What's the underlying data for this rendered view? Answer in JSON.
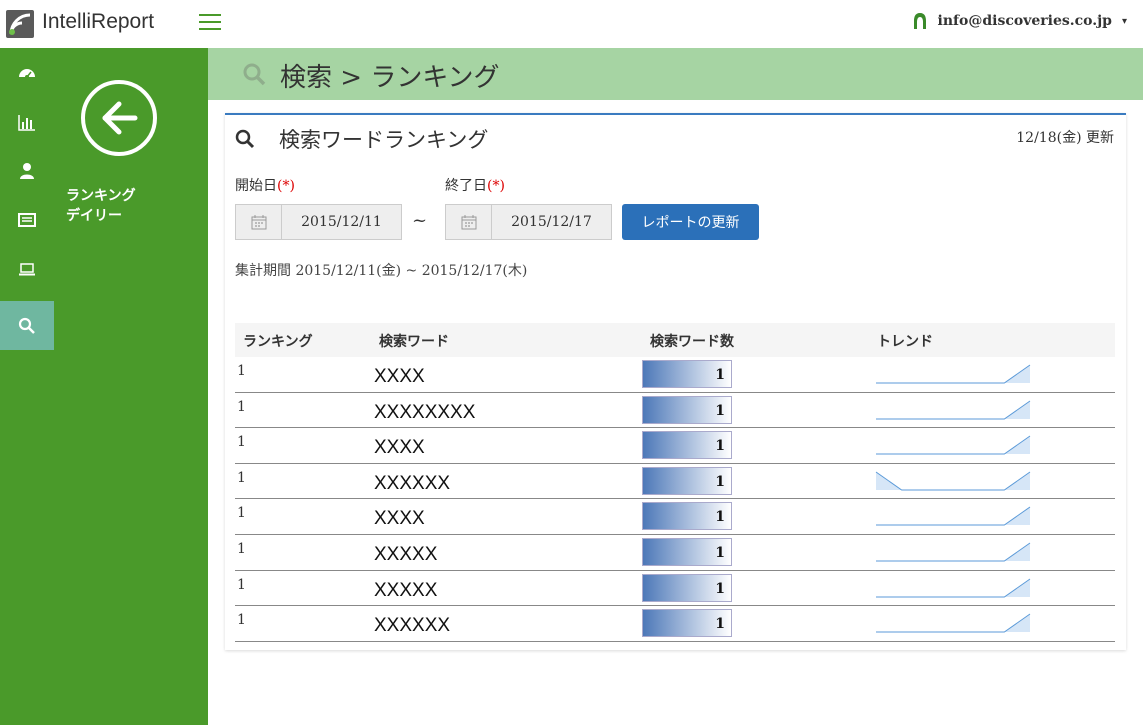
{
  "app": {
    "name": "IntelliReport"
  },
  "user": {
    "email": "info@discoveries.co.jp",
    "caret": "▾"
  },
  "sidebar": {
    "nav_icons": [
      "dashboard-icon",
      "bar-chart-icon",
      "user-icon",
      "list-icon",
      "laptop-icon",
      "search-icon"
    ],
    "title_line1": "ランキング",
    "title_line2": "デイリー"
  },
  "page": {
    "title": "検索 > ランキング"
  },
  "card": {
    "title": "検索ワードランキング",
    "updated": "12/18(金) 更新",
    "start_label": "開始日",
    "end_label": "終了日",
    "required_mark": "(*)",
    "start_date": "2015/12/11",
    "end_date": "2015/12/17",
    "tilde": "~",
    "update_button": "レポートの更新",
    "period": "集計期間 2015/12/11(金) ~ 2015/12/17(木)"
  },
  "table": {
    "headers": {
      "rank": "ランキング",
      "word": "検索ワード",
      "count": "検索ワード数",
      "trend": "トレンド"
    },
    "rows": [
      {
        "rank": "1",
        "word": "XXXX",
        "count": "1",
        "trend": [
          0,
          0,
          0,
          0,
          0,
          0,
          1
        ]
      },
      {
        "rank": "1",
        "word": "XXXXXXXX",
        "count": "1",
        "trend": [
          0,
          0,
          0,
          0,
          0,
          0,
          1
        ]
      },
      {
        "rank": "1",
        "word": "XXXX",
        "count": "1",
        "trend": [
          0,
          0,
          0,
          0,
          0,
          0,
          1
        ]
      },
      {
        "rank": "1",
        "word": "XXXXXX",
        "count": "1",
        "trend": [
          1,
          0,
          0,
          0,
          0,
          0,
          1
        ]
      },
      {
        "rank": "1",
        "word": "XXXX",
        "count": "1",
        "trend": [
          0,
          0,
          0,
          0,
          0,
          0,
          1
        ]
      },
      {
        "rank": "1",
        "word": "XXXXX",
        "count": "1",
        "trend": [
          0,
          0,
          0,
          0,
          0,
          0,
          1
        ]
      },
      {
        "rank": "1",
        "word": "XXXXX",
        "count": "1",
        "trend": [
          0,
          0,
          0,
          0,
          0,
          0,
          1
        ]
      },
      {
        "rank": "1",
        "word": "XXXXXX",
        "count": "1",
        "trend": [
          0,
          0,
          0,
          0,
          0,
          0,
          1
        ]
      }
    ]
  },
  "colors": {
    "sidebar": "#4a9a2a",
    "header": "#a6d4a3",
    "accent": "#2b70b9",
    "active_rail": "#6fb7a0"
  }
}
